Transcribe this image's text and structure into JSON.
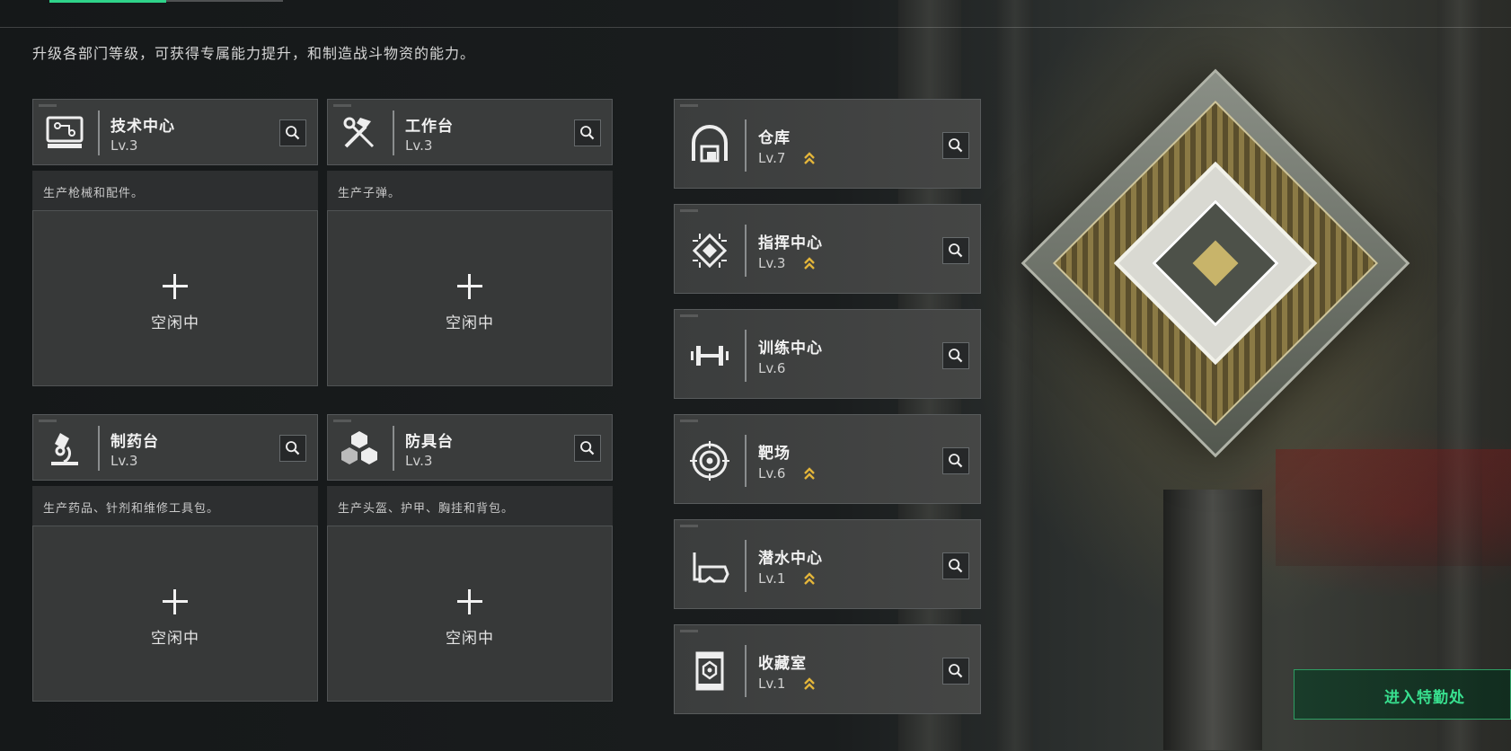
{
  "header": {
    "description": "升级各部门等级，可获得专属能力提升，和制造战斗物资的能力。"
  },
  "workstations": [
    {
      "name": "技术中心",
      "level": "Lv.3",
      "desc": "生产枪械和配件。",
      "slot_label": "空闲中",
      "icon": "computer-icon"
    },
    {
      "name": "工作台",
      "level": "Lv.3",
      "desc": "生产子弹。",
      "slot_label": "空闲中",
      "icon": "hammer-wrench-icon"
    },
    {
      "name": "制药台",
      "level": "Lv.3",
      "desc": "生产药品、针剂和维修工具包。",
      "slot_label": "空闲中",
      "icon": "microscope-icon"
    },
    {
      "name": "防具台",
      "level": "Lv.3",
      "desc": "生产头盔、护甲、胸挂和背包。",
      "slot_label": "空闲中",
      "icon": "armor-cubes-icon"
    }
  ],
  "facilities": [
    {
      "name": "仓库",
      "level": "Lv.7",
      "upgradable": true,
      "icon": "warehouse-icon"
    },
    {
      "name": "指挥中心",
      "level": "Lv.3",
      "upgradable": true,
      "icon": "chip-icon"
    },
    {
      "name": "训练中心",
      "level": "Lv.6",
      "upgradable": false,
      "icon": "dumbbell-icon"
    },
    {
      "name": "靶场",
      "level": "Lv.6",
      "upgradable": true,
      "icon": "target-icon"
    },
    {
      "name": "潜水中心",
      "level": "Lv.1",
      "upgradable": true,
      "icon": "diving-mask-icon"
    },
    {
      "name": "收藏室",
      "level": "Lv.1",
      "upgradable": true,
      "icon": "display-case-icon"
    }
  ],
  "actions": {
    "enter_label": "进入特勤处"
  },
  "colors": {
    "accent_green": "#2fd38a",
    "upgrade_gold": "#e3b53a"
  }
}
